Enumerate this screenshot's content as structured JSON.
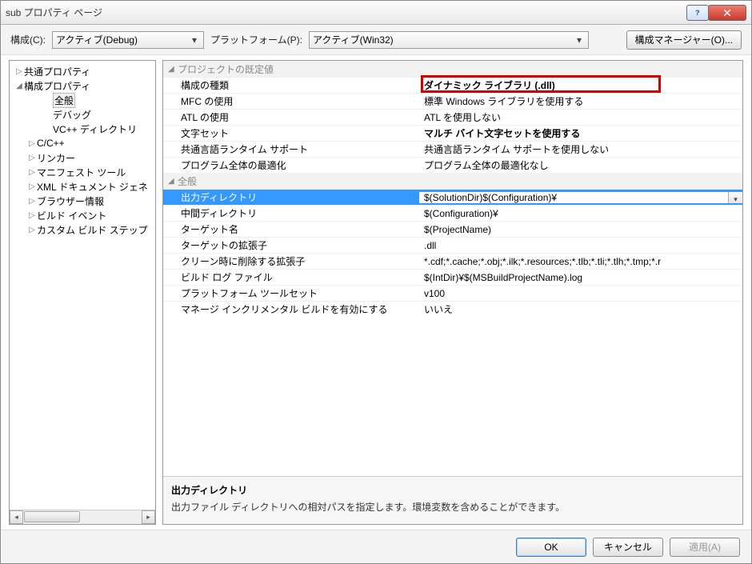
{
  "window": {
    "title": "sub プロパティ ページ"
  },
  "toolbar": {
    "config_label": "構成(C):",
    "config_value": "アクティブ(Debug)",
    "platform_label": "プラットフォーム(P):",
    "platform_value": "アクティブ(Win32)",
    "manager_button": "構成マネージャー(O)..."
  },
  "tree": {
    "items": [
      {
        "label": "共通プロパティ",
        "expand": "▷",
        "indent": 0
      },
      {
        "label": "構成プロパティ",
        "expand": "◢",
        "indent": 0
      },
      {
        "label": "全般",
        "indent": 2,
        "selected": true
      },
      {
        "label": "デバッグ",
        "indent": 2
      },
      {
        "label": "VC++ ディレクトリ",
        "indent": 2
      },
      {
        "label": "C/C++",
        "expand": "▷",
        "indent": 1
      },
      {
        "label": "リンカー",
        "expand": "▷",
        "indent": 1
      },
      {
        "label": "マニフェスト ツール",
        "expand": "▷",
        "indent": 1
      },
      {
        "label": "XML ドキュメント ジェネ",
        "expand": "▷",
        "indent": 1
      },
      {
        "label": "ブラウザー情報",
        "expand": "▷",
        "indent": 1
      },
      {
        "label": "ビルド イベント",
        "expand": "▷",
        "indent": 1
      },
      {
        "label": "カスタム ビルド ステップ",
        "expand": "▷",
        "indent": 1
      }
    ]
  },
  "grid": {
    "categories": [
      {
        "name": "プロジェクトの既定値",
        "rows": [
          {
            "k": "構成の種類",
            "v": "ダイナミック ライブラリ (.dll)",
            "bold": true,
            "highlight": true
          },
          {
            "k": "MFC の使用",
            "v": "標準 Windows ライブラリを使用する"
          },
          {
            "k": "ATL の使用",
            "v": "ATL を使用しない"
          },
          {
            "k": "文字セット",
            "v": "マルチ バイト文字セットを使用する",
            "bold": true
          },
          {
            "k": "共通言語ランタイム サポート",
            "v": "共通言語ランタイム サポートを使用しない"
          },
          {
            "k": "プログラム全体の最適化",
            "v": "プログラム全体の最適化なし"
          }
        ]
      },
      {
        "name": "全般",
        "rows": [
          {
            "k": "出力ディレクトリ",
            "v": "$(SolutionDir)$(Configuration)¥",
            "selected": true,
            "dropdown": true
          },
          {
            "k": "中間ディレクトリ",
            "v": "$(Configuration)¥"
          },
          {
            "k": "ターゲット名",
            "v": "$(ProjectName)"
          },
          {
            "k": "ターゲットの拡張子",
            "v": ".dll"
          },
          {
            "k": "クリーン時に削除する拡張子",
            "v": "*.cdf;*.cache;*.obj;*.ilk;*.resources;*.tlb;*.tli;*.tlh;*.tmp;*.r"
          },
          {
            "k": "ビルド ログ ファイル",
            "v": "$(IntDir)¥$(MSBuildProjectName).log"
          },
          {
            "k": "プラットフォーム ツールセット",
            "v": "v100"
          },
          {
            "k": "マネージ インクリメンタル ビルドを有効にする",
            "v": "いいえ"
          }
        ]
      }
    ]
  },
  "desc": {
    "title": "出力ディレクトリ",
    "text": "出力ファイル ディレクトリへの相対パスを指定します。環境変数を含めることができます。"
  },
  "footer": {
    "ok": "OK",
    "cancel": "キャンセル",
    "apply": "適用(A)"
  }
}
